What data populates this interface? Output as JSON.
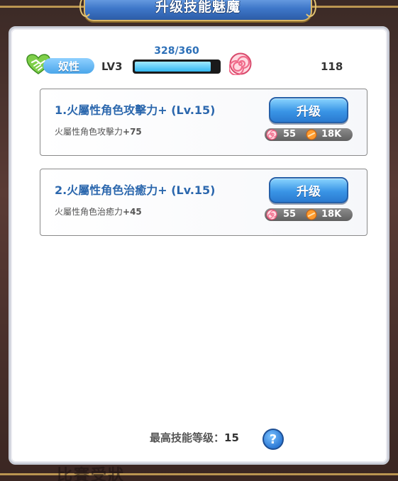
{
  "title": "升级技能魅魔",
  "header": {
    "trait_label": "奴性",
    "level": "LV3",
    "exp_text": "328/360",
    "exp_progress": 0.911,
    "skill_label": "技能点",
    "skill_points": "118"
  },
  "skills": [
    {
      "name": "1.火屬性角色攻擊力+ (Lv.15)",
      "desc_prefix": "火屬性角色攻擊力",
      "desc_value": "+75",
      "button": "升级",
      "cost_candy": "55",
      "cost_coin": "18K"
    },
    {
      "name": "2.火屬性角色治癒力+ (Lv.15)",
      "desc_prefix": "火屬性角色治癒力",
      "desc_value": "+45",
      "button": "升级",
      "cost_candy": "55",
      "cost_coin": "18K"
    }
  ],
  "footer": {
    "max_label": "最高技能等级：",
    "max_value": "15",
    "help_glyph": "?"
  },
  "background_text": "比賽受狀",
  "colors": {
    "accent_blue": "#2b67ad",
    "banner_gold": "#d8b565",
    "heart_green": "#7fcf4a",
    "candy_pink": "#f06a8a"
  },
  "icons": {
    "trait": "green-heart-handshake-icon",
    "skill": "pink-swirl-candy-icon",
    "coin": "orange-coin-icon",
    "help": "question-icon"
  }
}
